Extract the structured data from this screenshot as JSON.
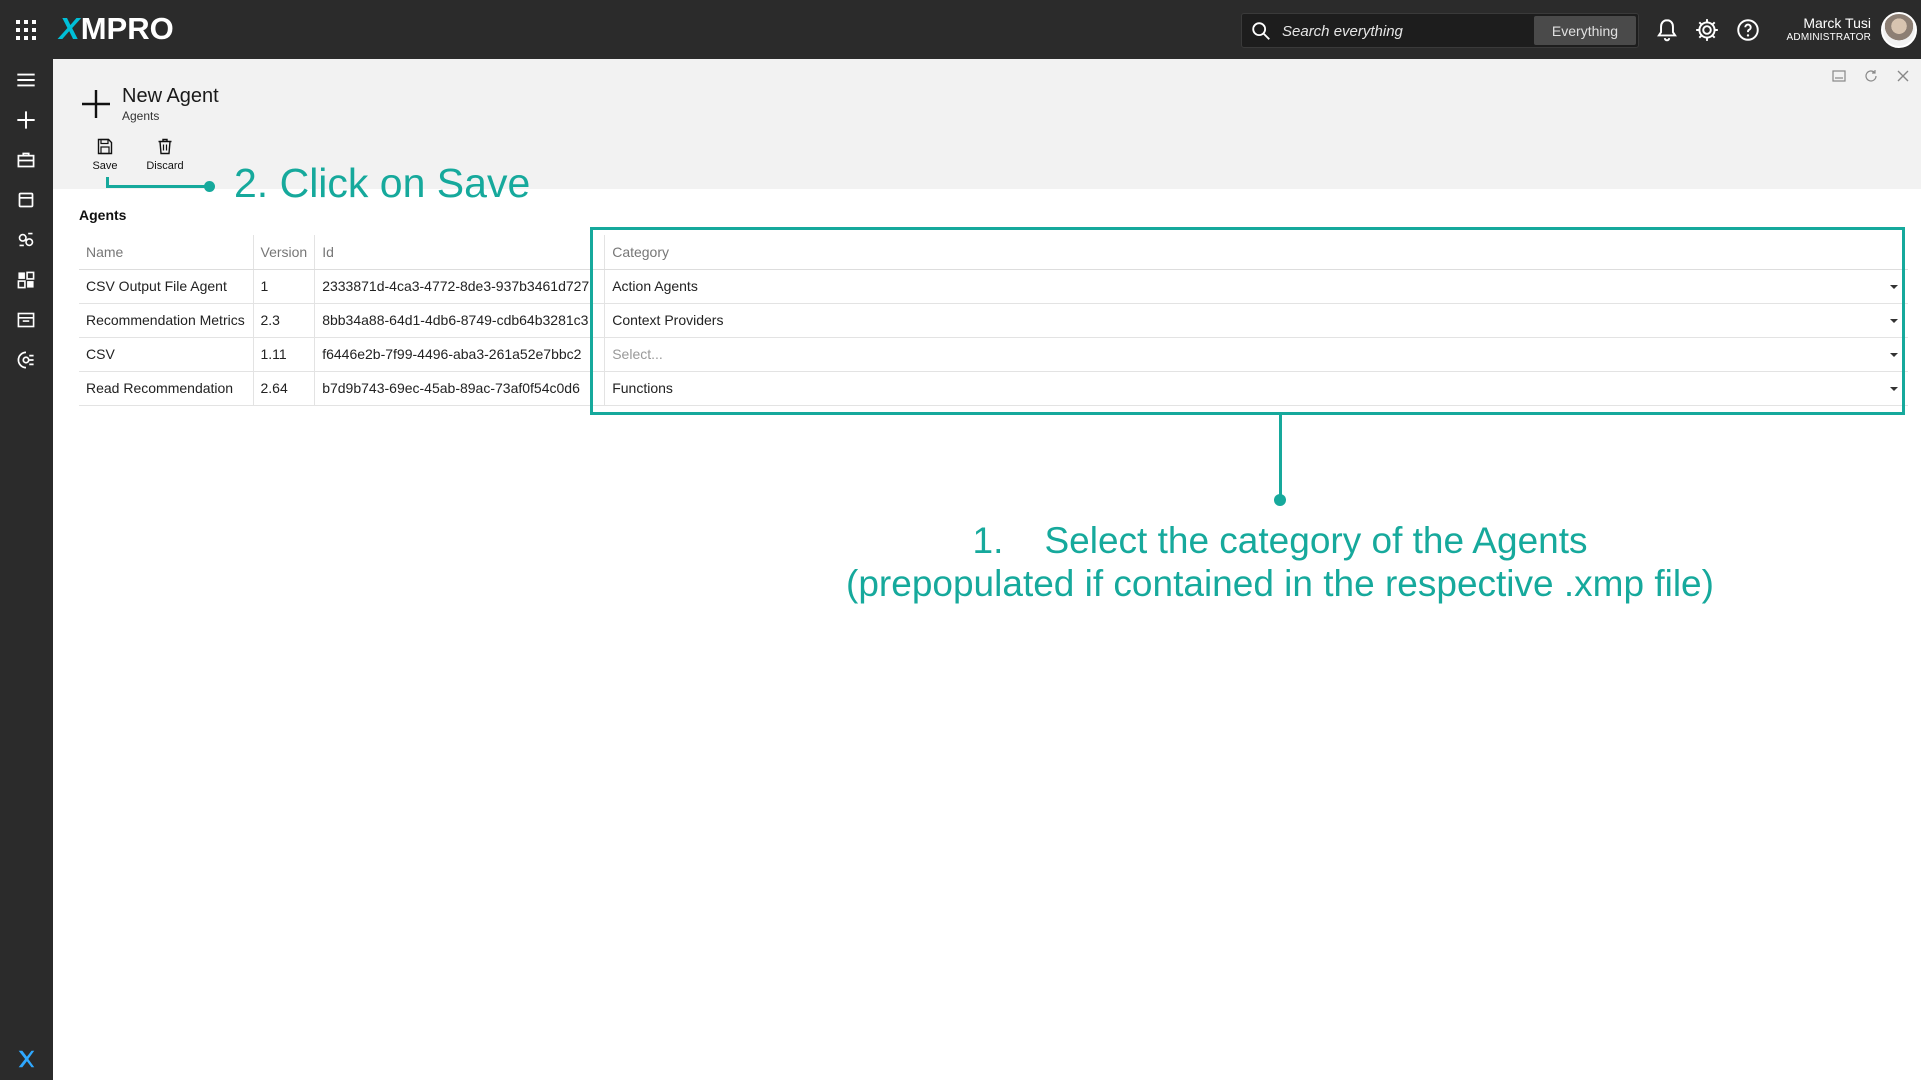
{
  "app": {
    "logo_text": "MPRO",
    "logo_prefix": "X"
  },
  "topbar": {
    "search_placeholder": "Search everything",
    "search_scope": "Everything",
    "user_name": "Marck Tusi",
    "user_role": "ADMINISTRATOR"
  },
  "page": {
    "title": "New Agent",
    "subtitle": "Agents"
  },
  "toolbar": {
    "save_label": "Save",
    "discard_label": "Discard"
  },
  "agents_section": {
    "label": "Agents",
    "columns": [
      "Name",
      "Version",
      "Id",
      "Category"
    ],
    "rows": [
      {
        "name": "CSV Output File Agent",
        "version": "1",
        "id": "2333871d-4ca3-4772-8de3-937b3461d727",
        "category": "Action Agents"
      },
      {
        "name": "Recommendation Metrics",
        "version": "2.3",
        "id": "8bb34a88-64d1-4db6-8749-cdb64b3281c3",
        "category": "Context Providers"
      },
      {
        "name": "CSV",
        "version": "1.11",
        "id": "f6446e2b-7f99-4496-aba3-261a52e7bbc2",
        "category_placeholder": "Select..."
      },
      {
        "name": "Read Recommendation",
        "version": "2.64",
        "id": "b7d9b743-69ec-45ab-89ac-73af0f54c0d6",
        "category": "Functions"
      }
    ]
  },
  "annotations": {
    "save_hint": "2. Click on Save",
    "category_hint_line1": "1.    Select the category of the Agents",
    "category_hint_line2": "(prepopulated if contained in the respective .xmp file)",
    "accent_color": "#16a99c"
  },
  "colors": {
    "topbar_bg": "#2b2b2b",
    "header_bg": "#f2f2f2",
    "logo_x": "#00bfd8"
  },
  "icons": [
    "apps-grid-icon",
    "search-icon",
    "bell-icon",
    "gear-icon",
    "help-icon",
    "menu-icon",
    "plus-icon",
    "briefcase-icon",
    "calendar-icon",
    "agents-icon",
    "dashboard-icon",
    "recommendations-icon",
    "ai-icon",
    "xmpro-x-icon",
    "minimize-icon",
    "refresh-icon",
    "close-icon",
    "save-icon",
    "trash-icon"
  ]
}
